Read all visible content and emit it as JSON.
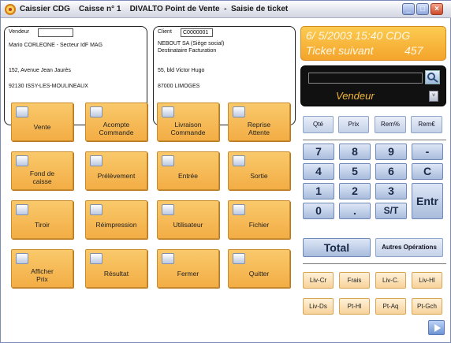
{
  "window": {
    "title": "Caissier CDG    Caisse n° 1    DIVALTO Point de Vente  -  Saisie de ticket",
    "controls": {
      "minimize": "_",
      "maximize": "□",
      "close": "×"
    }
  },
  "vendeur_box": {
    "label": "Vendeur",
    "value": "",
    "line1": "Mario CORLEONE - Secteur IdF MAG",
    "line2": "152, Avenue Jean Jaurès",
    "line3": "92130 ISSY-LES-MOULINEAUX"
  },
  "client_box": {
    "label": "Client",
    "value": "C0000001",
    "line1": "NEBOUT SA (Siège social)",
    "line2": "Destinataire Facturation",
    "line3": "55, bld Victor Hugo",
    "line4": "87000 LIMOGES"
  },
  "banner": {
    "datetime": "6/ 5/2003 15:40 CDG",
    "next_ticket_label": "Ticket suivant",
    "next_ticket_number": "457"
  },
  "vendeur_panel": {
    "input_value": "",
    "label": "Vendeur",
    "dropdown": "˅"
  },
  "actions": [
    {
      "id": "vente",
      "label": "Vente"
    },
    {
      "id": "acompte",
      "label": "Acompte\nCommande"
    },
    {
      "id": "livraison",
      "label": "Livraison\nCommande"
    },
    {
      "id": "reprise",
      "label": "Reprise\nAttente"
    },
    {
      "id": "fond",
      "label": "Fond de\ncaisse"
    },
    {
      "id": "prelevement",
      "label": "Prélèvement"
    },
    {
      "id": "entree",
      "label": "Entrée"
    },
    {
      "id": "sortie",
      "label": "Sortie"
    },
    {
      "id": "tiroir",
      "label": "Tiroir"
    },
    {
      "id": "reimpression",
      "label": "Réimpression"
    },
    {
      "id": "utilisateur",
      "label": "Utilisateur"
    },
    {
      "id": "fichier",
      "label": "Fichier"
    },
    {
      "id": "afficher",
      "label": "Afficher\nPrix"
    },
    {
      "id": "resultat",
      "label": "Résultat"
    },
    {
      "id": "fermer",
      "label": "Fermer"
    },
    {
      "id": "quitter",
      "label": "Quitter"
    }
  ],
  "modifiers": [
    "Qté",
    "Prix",
    "Rem%",
    "Rem€"
  ],
  "keypad": {
    "k7": "7",
    "k8": "8",
    "k9": "9",
    "kminus": "-",
    "k4": "4",
    "k5": "5",
    "k6": "6",
    "kc": "C",
    "k1": "1",
    "k2": "2",
    "k3": "3",
    "kentr": "Entr",
    "k0": "0",
    "kdot": ".",
    "kst": "S/T",
    "total": "Total",
    "autres": "Autres Opérations"
  },
  "shortcuts_row1": [
    "Liv-Cr",
    "Frais",
    "Liv-C.",
    "Liv-Hl"
  ],
  "shortcuts_row2": [
    "Liv-Ds",
    "Pt-Hl",
    "Pt-Aq",
    "Pt-Gch"
  ]
}
